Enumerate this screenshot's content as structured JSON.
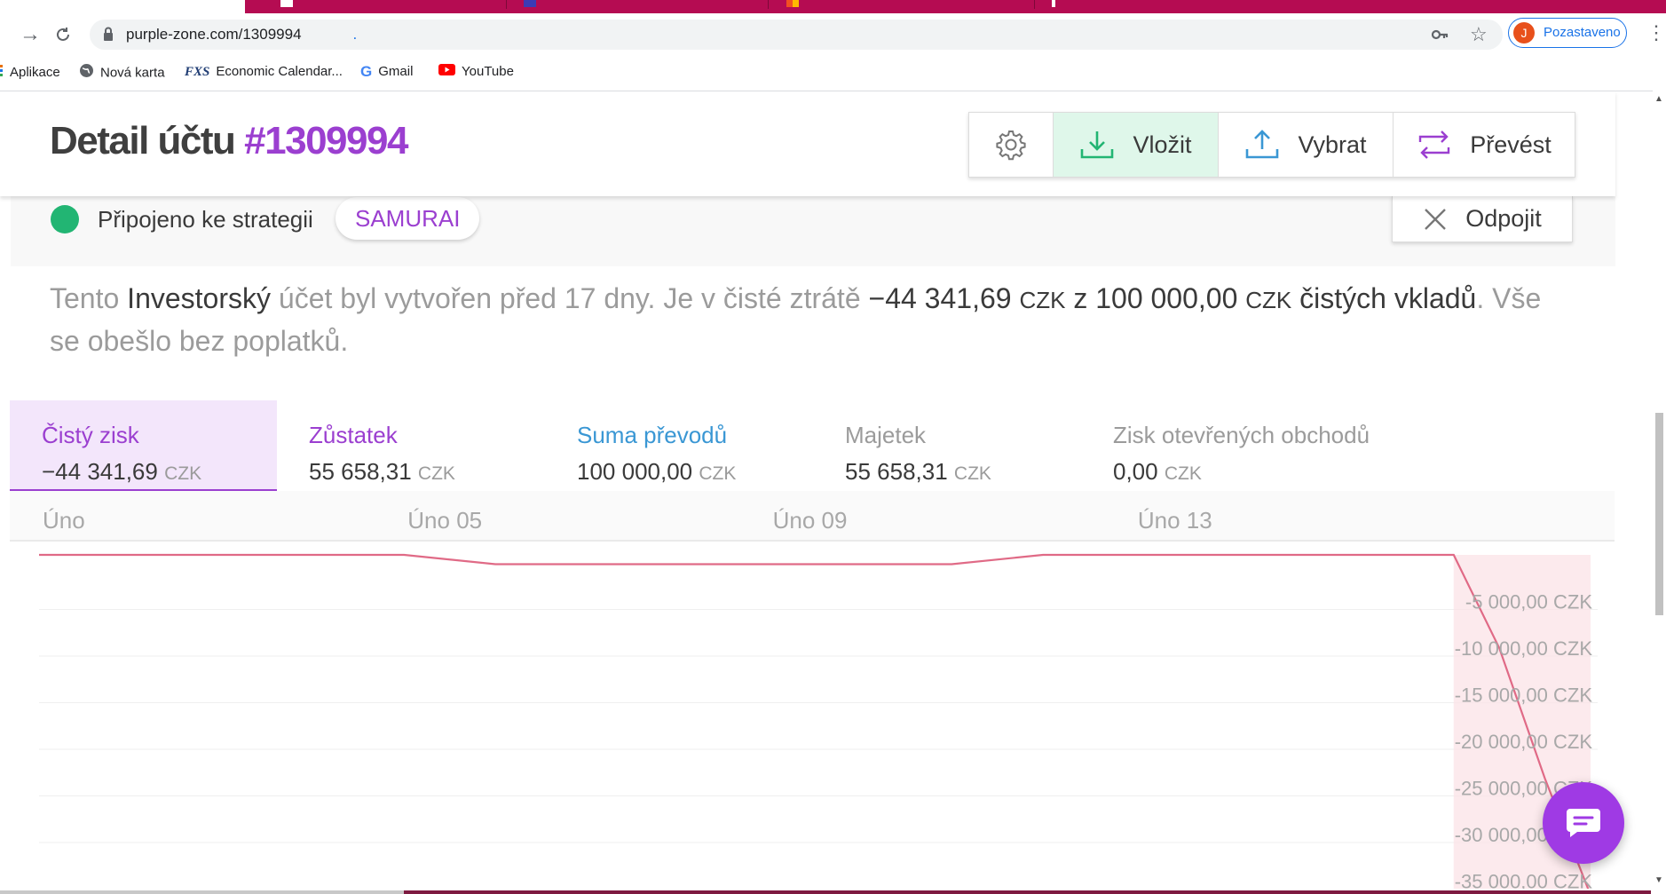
{
  "browser": {
    "url": "purple-zone.com/1309994",
    "url_extra": ".",
    "profile_initial": "J",
    "profile_status": "Pozastaveno",
    "bookmarks": [
      {
        "label": "Aplikace",
        "icon": "apps-icon"
      },
      {
        "label": "Nová karta",
        "icon": "globe-icon"
      },
      {
        "label": "Economic Calendar...",
        "icon": "fxs-icon"
      },
      {
        "label": "Gmail",
        "icon": "google-icon"
      },
      {
        "label": "YouTube",
        "icon": "youtube-icon"
      }
    ]
  },
  "header": {
    "title_prefix": "Detail účtu",
    "account_number": "#1309994",
    "buttons": {
      "settings_icon": "gear-icon",
      "deposit": "Vložit",
      "withdraw": "Vybrat",
      "transfer": "Převést"
    }
  },
  "strategy": {
    "status_color": "#22b573",
    "label": "Připojeno ke strategii",
    "name": "SAMURAI",
    "disconnect": "Odpojit"
  },
  "summary": {
    "t1": "Tento ",
    "account_type": "Investorský",
    "t2": " účet byl vytvořen před 17 dny. Je v čisté ztrátě ",
    "loss": "−44 341,69",
    "cur1": "CZK",
    "t3": " z ",
    "deposits": "100 000,00",
    "cur2": "CZK",
    "t4": " čistých vkladů",
    "t5": ". Vše se obešlo bez poplatků."
  },
  "stats": [
    {
      "label": "Čistý zisk",
      "value": "−44 341,69",
      "currency": "CZK",
      "color": "#9b3fd0",
      "active": true
    },
    {
      "label": "Zůstatek",
      "value": "55 658,31",
      "currency": "CZK",
      "color": "#9b3fd0",
      "active": false
    },
    {
      "label": "Suma převodů",
      "value": "100 000,00",
      "currency": "CZK",
      "color": "#3a97d4",
      "active": false
    },
    {
      "label": "Majetek",
      "value": "55 658,31",
      "currency": "CZK",
      "color": "#9b9b9b",
      "active": false
    },
    {
      "label": "Zisk otevřených obchodů",
      "value": "0,00",
      "currency": "CZK",
      "color": "#9b9b9b",
      "active": false
    }
  ],
  "chart_data": {
    "type": "line",
    "x_tick_labels": [
      "Úno",
      "Úno 05",
      "Úno 09",
      "Úno 13"
    ],
    "y_tick_labels": [
      "-5 000,00 CZK",
      "-10 000,00 CZK",
      "-15 000,00 CZK",
      "-20 000,00 CZK",
      "-25 000,00 CZK",
      "-30 000,00 CZK",
      "-35 000,00 CZK"
    ],
    "ylim": [
      -37000,
      0
    ],
    "x_range": [
      1,
      18
    ],
    "grid": true,
    "series": [
      {
        "color": "#e06a86",
        "points": [
          [
            1,
            0
          ],
          [
            5,
            0
          ],
          [
            6,
            -1000
          ],
          [
            11,
            -1000
          ],
          [
            12,
            0
          ],
          [
            16.5,
            0
          ],
          [
            17,
            -10000
          ],
          [
            17.5,
            -24000
          ],
          [
            18,
            -36500
          ]
        ]
      }
    ]
  },
  "chat": {
    "icon": "chat-icon",
    "color": "#9f3ae4"
  }
}
